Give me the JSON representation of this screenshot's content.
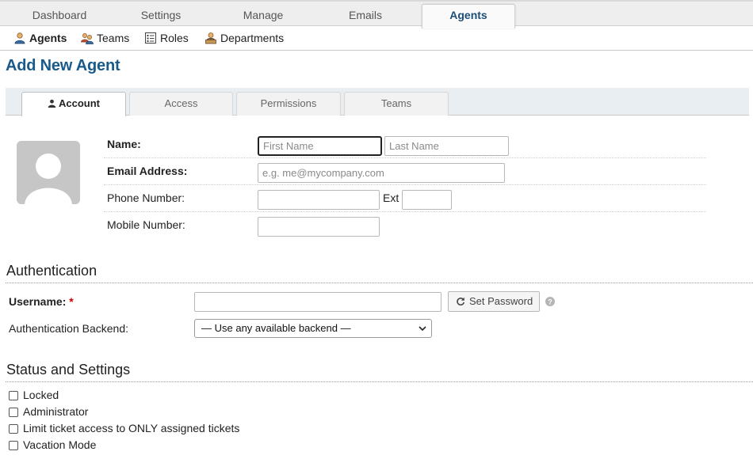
{
  "top_tabs": [
    {
      "label": "Dashboard",
      "active": false
    },
    {
      "label": "Settings",
      "active": false
    },
    {
      "label": "Manage",
      "active": false
    },
    {
      "label": "Emails",
      "active": false
    },
    {
      "label": "Agents",
      "active": true
    }
  ],
  "sub_nav": [
    {
      "label": "Agents",
      "icon": "agent-icon",
      "active": true
    },
    {
      "label": "Teams",
      "icon": "teams-icon",
      "active": false
    },
    {
      "label": "Roles",
      "icon": "roles-icon",
      "active": false
    },
    {
      "label": "Departments",
      "icon": "departments-icon",
      "active": false
    }
  ],
  "page_title": "Add New Agent",
  "form_tabs": [
    {
      "label": "Account",
      "icon": "user-icon",
      "active": true
    },
    {
      "label": "Access",
      "active": false
    },
    {
      "label": "Permissions",
      "active": false
    },
    {
      "label": "Teams",
      "active": false
    }
  ],
  "account": {
    "name_label": "Name:",
    "first_name_placeholder": "First Name",
    "last_name_placeholder": "Last Name",
    "email_label": "Email Address:",
    "email_placeholder": "e.g. me@mycompany.com",
    "phone_label": "Phone Number:",
    "ext_label": "Ext",
    "mobile_label": "Mobile Number:"
  },
  "authentication": {
    "heading": "Authentication",
    "username_label": "Username:",
    "required_mark": "*",
    "set_password_label": "Set Password",
    "backend_label": "Authentication Backend:",
    "backend_selected": "— Use any available backend —"
  },
  "status": {
    "heading": "Status and Settings",
    "options": [
      {
        "label": "Locked",
        "checked": false
      },
      {
        "label": "Administrator",
        "checked": false
      },
      {
        "label": "Limit ticket access to ONLY assigned tickets",
        "checked": false
      },
      {
        "label": "Vacation Mode",
        "checked": false
      }
    ]
  },
  "colors": {
    "accent": "#1a5a8a",
    "required": "#cc0000"
  }
}
